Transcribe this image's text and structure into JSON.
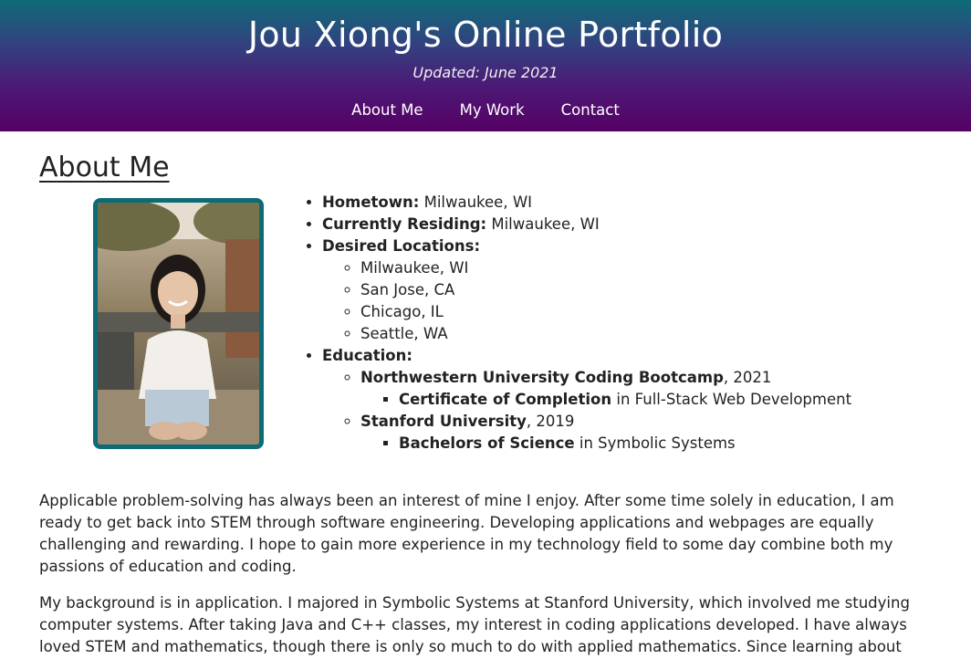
{
  "header": {
    "title": "Jou Xiong's Online Portfolio",
    "updated": "Updated: June 2021",
    "nav": [
      "About Me",
      "My Work",
      "Contact"
    ]
  },
  "about": {
    "heading": "About Me",
    "hometown_label": "Hometown:",
    "hometown": " Milwaukee, WI",
    "residing_label": "Currently Residing:",
    "residing": " Milwaukee, WI",
    "desired_label": "Desired Locations:",
    "desired": [
      "Milwaukee, WI",
      "San Jose, CA",
      "Chicago, IL",
      "Seattle, WA"
    ],
    "education_label": "Education:",
    "edu1_school": "Northwestern University Coding Bootcamp",
    "edu1_year": ", 2021",
    "edu1_cert": "Certificate of Completion",
    "edu1_field": " in Full-Stack Web Development",
    "edu2_school": "Stanford University",
    "edu2_year": ", 2019",
    "edu2_degree": "Bachelors of Science",
    "edu2_field": " in Symbolic Systems",
    "paragraphs": [
      "Applicable problem-solving has always been an interest of mine I enjoy. After some time solely in education, I am ready to get back into STEM through software engineering. Developing applications and webpages are equally challenging and rewarding. I hope to gain more experience in my technology field to some day combine both my passions of education and coding.",
      "My background is in application. I majored in Symbolic Systems at Stanford University, which involved me studying computer systems. After taking Java and C++ classes, my interest in coding applications developed. I have always loved STEM and mathematics, though there is only so much to do with applied mathematics. Since learning about"
    ]
  },
  "colors": {
    "header_top": "#0f6b78",
    "header_bottom": "#550064",
    "photo_border": "#0d6b75"
  },
  "icons": [
    "bullet-disc-icon",
    "bullet-circle-icon",
    "bullet-square-icon"
  ]
}
